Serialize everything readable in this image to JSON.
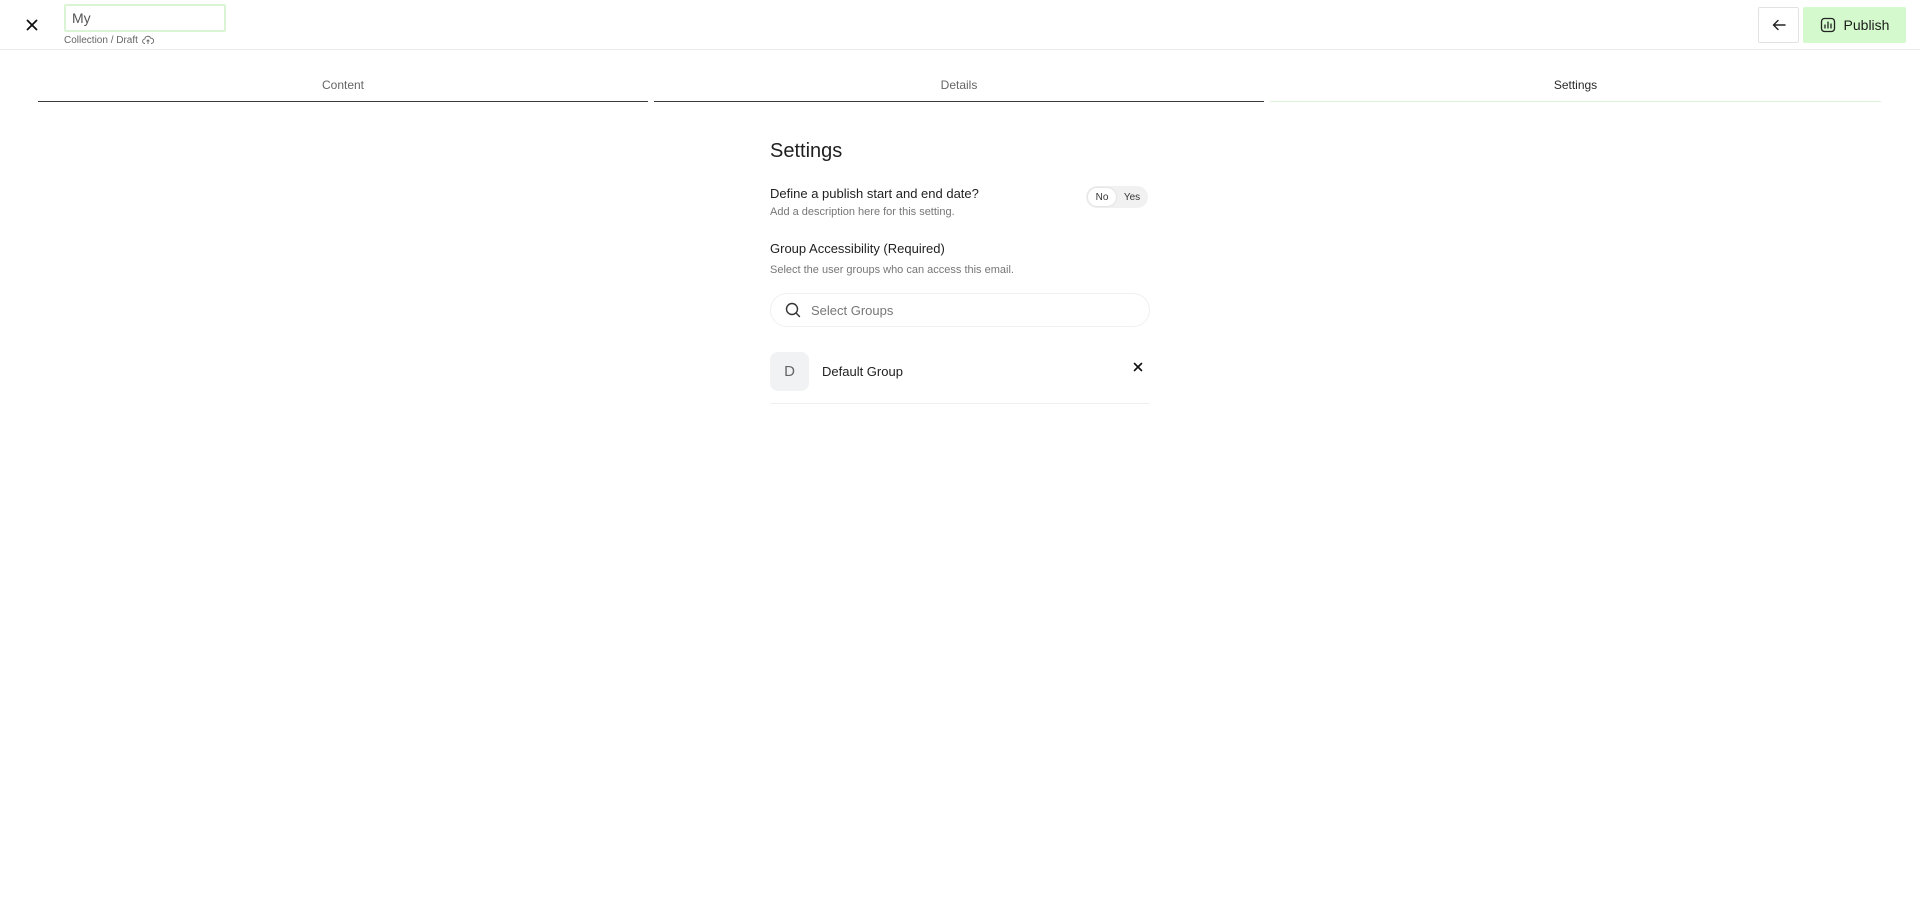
{
  "header": {
    "title_value": "My",
    "breadcrumb": "Collection / Draft",
    "publish_label": "Publish"
  },
  "tabs": [
    {
      "label": "Content"
    },
    {
      "label": "Details"
    },
    {
      "label": "Settings"
    }
  ],
  "settings": {
    "title": "Settings",
    "publish_dates": {
      "label": "Define a publish start and end date?",
      "description": "Add a description here for this setting.",
      "options": [
        "No",
        "Yes"
      ],
      "selected": "No"
    },
    "group_access": {
      "label": "Group Accessibility (Required)",
      "description": "Select the user groups who can access this email.",
      "search_placeholder": "Select Groups",
      "groups": [
        {
          "initial": "D",
          "name": "Default Group"
        }
      ]
    }
  },
  "colors": {
    "accent_green": "#d3f9cc",
    "input_focus_border": "#d9f5d4"
  },
  "icons": {
    "close": "close-icon",
    "cloud": "cloud-upload-icon",
    "back": "arrow-left-icon",
    "publish": "publish-icon",
    "search": "search-icon",
    "remove": "remove-icon"
  }
}
